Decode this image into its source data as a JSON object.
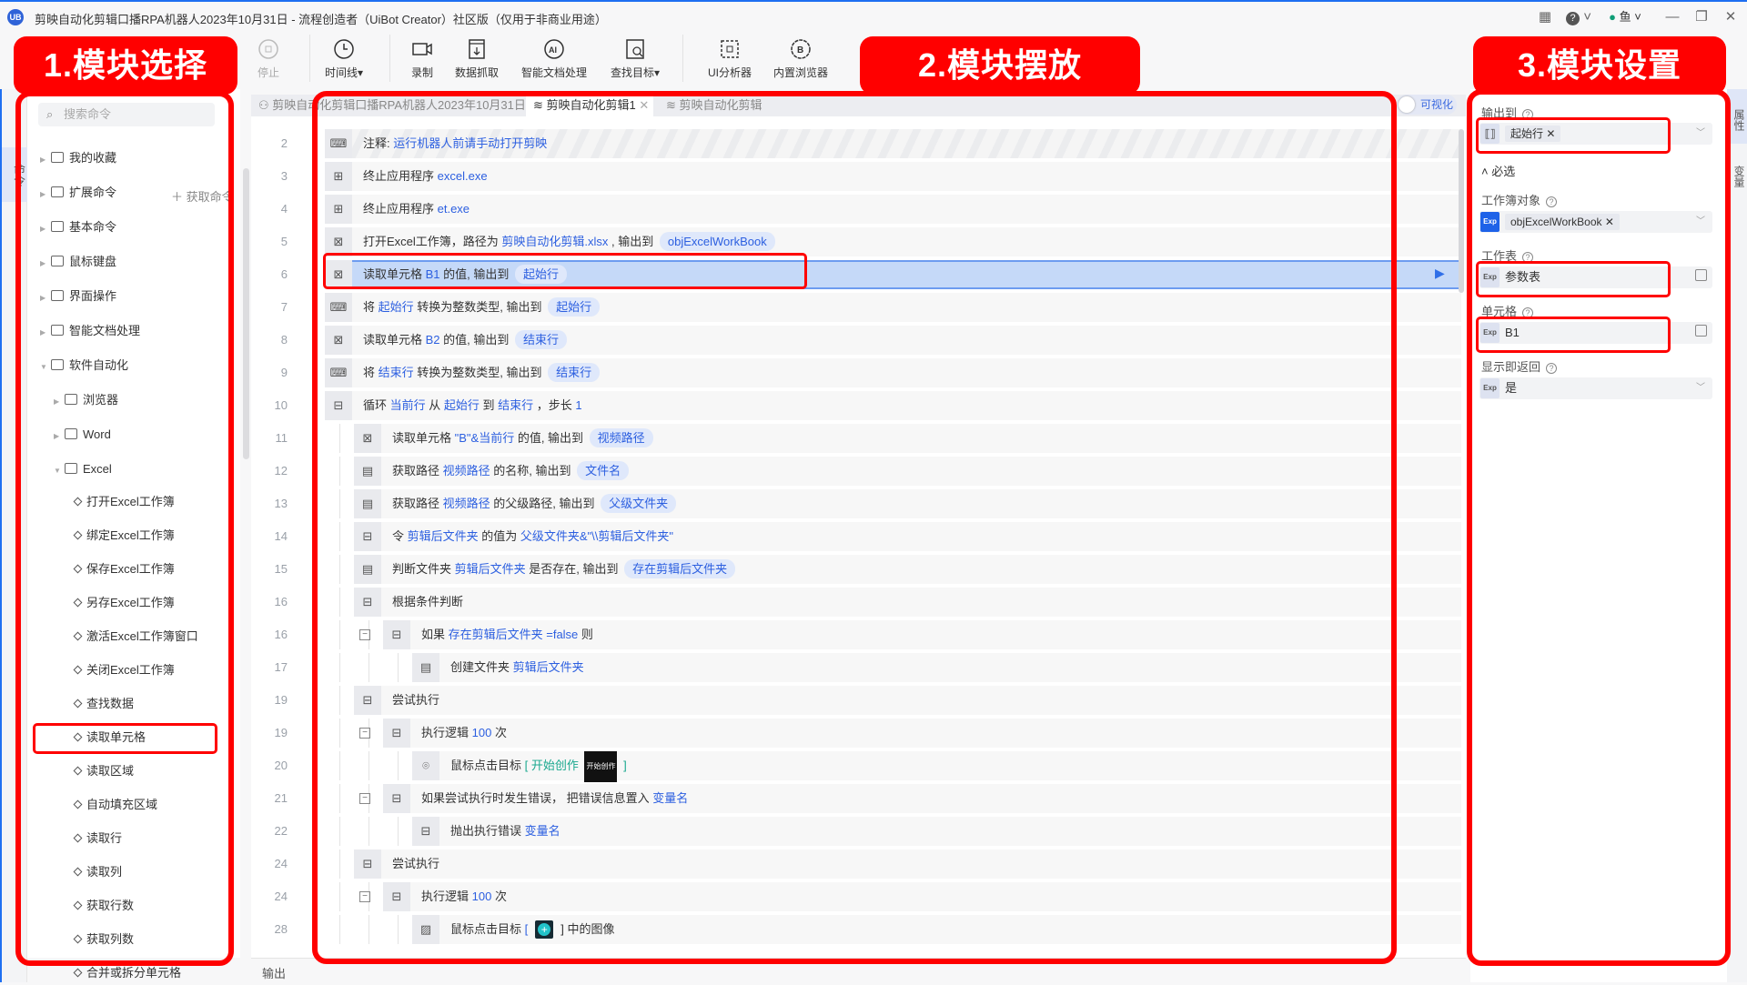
{
  "window": {
    "title": "剪映自动化剪辑口播RPA机器人2023年10月31日 - 流程创造者（UiBot Creator）社区版（仅用于非商业用途）",
    "logo": "UB",
    "user": "鱼",
    "controls": [
      "apps-icon",
      "help-icon",
      "minimize-icon",
      "restore-icon",
      "close-icon"
    ]
  },
  "toolbar": {
    "items": [
      {
        "label": "停止",
        "icon": "stop-icon"
      },
      {
        "label": "时间线▾",
        "icon": "clock-icon"
      },
      {
        "label": "录制",
        "icon": "record-icon"
      },
      {
        "label": "数据抓取",
        "icon": "data-scrape-icon"
      },
      {
        "label": "智能文档处理",
        "icon": "ai-doc-icon"
      },
      {
        "label": "查找目标▾",
        "icon": "find-target-icon"
      },
      {
        "label": "UI分析器",
        "icon": "ui-analyzer-icon"
      },
      {
        "label": "内置浏览器",
        "icon": "browser-icon"
      }
    ]
  },
  "annotations": {
    "section1": "1.模块选择",
    "section2": "2.模块摆放",
    "section3": "3.模块设置",
    "color": "#ff0000"
  },
  "left_strip": {
    "tab": "命令"
  },
  "command_panel": {
    "search_placeholder": "搜索命令",
    "get_commands": "获取命令",
    "categories": [
      {
        "label": "我的收藏",
        "level": 0,
        "expanded": false
      },
      {
        "label": "扩展命令",
        "level": 0,
        "expanded": false
      },
      {
        "label": "基本命令",
        "level": 0,
        "expanded": false
      },
      {
        "label": "鼠标键盘",
        "level": 0,
        "expanded": false
      },
      {
        "label": "界面操作",
        "level": 0,
        "expanded": false
      },
      {
        "label": "智能文档处理",
        "level": 0,
        "expanded": false
      },
      {
        "label": "软件自动化",
        "level": 0,
        "expanded": true
      },
      {
        "label": "浏览器",
        "level": 1,
        "expanded": false
      },
      {
        "label": "Word",
        "level": 1,
        "expanded": false
      },
      {
        "label": "Excel",
        "level": 1,
        "expanded": true
      }
    ],
    "excel_commands": [
      "打开Excel工作簿",
      "绑定Excel工作簿",
      "保存Excel工作簿",
      "另存Excel工作簿",
      "激活Excel工作簿窗口",
      "关闭Excel工作簿",
      "查找数据",
      "读取单元格",
      "读取区域",
      "自动填充区域",
      "读取行",
      "读取列",
      "获取行数",
      "获取列数",
      "合并或拆分单元格"
    ],
    "selected_command": "读取单元格"
  },
  "editor": {
    "tabs": [
      {
        "label": "剪映自动化剪辑口播RPA机器人2023年10月31日",
        "active": false
      },
      {
        "label": "剪映自动化剪辑1",
        "active": true
      },
      {
        "label": "剪映自动化剪辑",
        "active": false
      }
    ],
    "visual_toggle": "可视化",
    "output_label": "输出",
    "rows": [
      {
        "line": "2",
        "indent": 0,
        "icon": "terminal-icon",
        "comment": true,
        "segs": [
          {
            "t": "注释: ",
            "s": "plain"
          },
          {
            "t": "运行机器人前请手动打开剪映",
            "s": "var"
          }
        ]
      },
      {
        "line": "3",
        "indent": 0,
        "icon": "apps-icon",
        "segs": [
          {
            "t": "终止应用程序 ",
            "s": "plain"
          },
          {
            "t": "excel.exe",
            "s": "var"
          }
        ]
      },
      {
        "line": "4",
        "indent": 0,
        "icon": "apps-icon",
        "segs": [
          {
            "t": "终止应用程序 ",
            "s": "plain"
          },
          {
            "t": "et.exe",
            "s": "var"
          }
        ]
      },
      {
        "line": "5",
        "indent": 0,
        "icon": "excel-icon",
        "segs": [
          {
            "t": "打开Excel工作簿，路径为 ",
            "s": "plain"
          },
          {
            "t": "剪映自动化剪辑.xlsx",
            "s": "var"
          },
          {
            "t": " , 输出到 ",
            "s": "plain"
          },
          {
            "t": "objExcelWorkBook",
            "s": "pill"
          }
        ]
      },
      {
        "line": "6",
        "indent": 0,
        "icon": "excel-icon",
        "selected": true,
        "segs": [
          {
            "t": "读取单元格 ",
            "s": "plain"
          },
          {
            "t": "B1",
            "s": "var"
          },
          {
            "t": " 的值, 输出到 ",
            "s": "plain"
          },
          {
            "t": "起始行",
            "s": "pill"
          }
        ]
      },
      {
        "line": "7",
        "indent": 0,
        "icon": "terminal-icon",
        "segs": [
          {
            "t": "将 ",
            "s": "plain"
          },
          {
            "t": "起始行",
            "s": "var"
          },
          {
            "t": " 转换为整数类型, 输出到 ",
            "s": "plain"
          },
          {
            "t": "起始行",
            "s": "pill"
          }
        ]
      },
      {
        "line": "8",
        "indent": 0,
        "icon": "excel-icon",
        "segs": [
          {
            "t": "读取单元格 ",
            "s": "plain"
          },
          {
            "t": "B2",
            "s": "var"
          },
          {
            "t": " 的值, 输出到 ",
            "s": "plain"
          },
          {
            "t": "结束行",
            "s": "pill"
          }
        ]
      },
      {
        "line": "9",
        "indent": 0,
        "icon": "terminal-icon",
        "segs": [
          {
            "t": "将 ",
            "s": "plain"
          },
          {
            "t": "结束行",
            "s": "var"
          },
          {
            "t": " 转换为整数类型, 输出到 ",
            "s": "plain"
          },
          {
            "t": "结束行",
            "s": "pill"
          }
        ]
      },
      {
        "line": "10",
        "indent": 0,
        "icon": "flow-icon",
        "segs": [
          {
            "t": "循环 ",
            "s": "plain"
          },
          {
            "t": "当前行",
            "s": "var"
          },
          {
            "t": " 从 ",
            "s": "plain"
          },
          {
            "t": "起始行",
            "s": "var"
          },
          {
            "t": " 到 ",
            "s": "plain"
          },
          {
            "t": "结束行",
            "s": "var"
          },
          {
            "t": " ，步长 ",
            "s": "plain"
          },
          {
            "t": "1",
            "s": "var"
          }
        ]
      },
      {
        "line": "11",
        "indent": 1,
        "icon": "excel-icon",
        "segs": [
          {
            "t": "读取单元格 ",
            "s": "plain"
          },
          {
            "t": "\"B\"&当前行",
            "s": "var"
          },
          {
            "t": " 的值, 输出到 ",
            "s": "plain"
          },
          {
            "t": "视频路径",
            "s": "pill"
          }
        ]
      },
      {
        "line": "12",
        "indent": 1,
        "icon": "file-icon",
        "segs": [
          {
            "t": "获取路径 ",
            "s": "plain"
          },
          {
            "t": "视频路径",
            "s": "var"
          },
          {
            "t": " 的名称, 输出到 ",
            "s": "plain"
          },
          {
            "t": "文件名",
            "s": "pill"
          }
        ]
      },
      {
        "line": "13",
        "indent": 1,
        "icon": "file-icon",
        "segs": [
          {
            "t": "获取路径 ",
            "s": "plain"
          },
          {
            "t": "视频路径",
            "s": "var"
          },
          {
            "t": " 的父级路径, 输出到 ",
            "s": "plain"
          },
          {
            "t": "父级文件夹",
            "s": "pill"
          }
        ]
      },
      {
        "line": "14",
        "indent": 1,
        "icon": "flow-icon",
        "segs": [
          {
            "t": "令 ",
            "s": "plain"
          },
          {
            "t": "剪辑后文件夹",
            "s": "var"
          },
          {
            "t": " 的值为 ",
            "s": "plain"
          },
          {
            "t": "父级文件夹&\"\\\\剪辑后文件夹\"",
            "s": "var"
          }
        ]
      },
      {
        "line": "15",
        "indent": 1,
        "icon": "file-icon",
        "segs": [
          {
            "t": "判断文件夹 ",
            "s": "plain"
          },
          {
            "t": "剪辑后文件夹",
            "s": "var"
          },
          {
            "t": " 是否存在, 输出到 ",
            "s": "plain"
          },
          {
            "t": "存在剪辑后文件夹",
            "s": "pill"
          }
        ]
      },
      {
        "line": "16",
        "indent": 1,
        "icon": "flow-icon",
        "segs": [
          {
            "t": "根据条件判断",
            "s": "plain"
          }
        ]
      },
      {
        "line": "16",
        "indent": 2,
        "icon": "flow-icon",
        "collapse": true,
        "segs": [
          {
            "t": "如果 ",
            "s": "plain"
          },
          {
            "t": "存在剪辑后文件夹 =false",
            "s": "var"
          },
          {
            "t": " 则",
            "s": "plain"
          }
        ]
      },
      {
        "line": "17",
        "indent": 3,
        "icon": "file-icon",
        "segs": [
          {
            "t": "创建文件夹 ",
            "s": "plain"
          },
          {
            "t": "剪辑后文件夹",
            "s": "var"
          }
        ]
      },
      {
        "line": "19",
        "indent": 1,
        "icon": "flow-icon",
        "segs": [
          {
            "t": "尝试执行",
            "s": "plain"
          }
        ]
      },
      {
        "line": "19",
        "indent": 2,
        "icon": "flow-icon",
        "collapse": true,
        "segs": [
          {
            "t": "执行逻辑 ",
            "s": "plain"
          },
          {
            "t": "100",
            "s": "var"
          },
          {
            "t": " 次",
            "s": "plain"
          }
        ]
      },
      {
        "line": "20",
        "indent": 3,
        "icon": "mouse-icon",
        "segs": [
          {
            "t": "鼠标点击目标 ",
            "s": "plain"
          },
          {
            "t": "[ 开始创作 ",
            "s": "green"
          },
          {
            "t": "开始创作",
            "s": "thumb"
          },
          {
            "t": " ]",
            "s": "green"
          }
        ]
      },
      {
        "line": "21",
        "indent": 2,
        "icon": "flow-icon",
        "collapse": true,
        "segs": [
          {
            "t": "如果尝试执行时发生错误， 把错误信息置入 ",
            "s": "plain"
          },
          {
            "t": "变量名",
            "s": "var"
          }
        ]
      },
      {
        "line": "22",
        "indent": 3,
        "icon": "flow-icon",
        "segs": [
          {
            "t": "抛出执行错误 ",
            "s": "plain"
          },
          {
            "t": "变量名",
            "s": "var"
          }
        ]
      },
      {
        "line": "24",
        "indent": 1,
        "icon": "flow-icon",
        "segs": [
          {
            "t": "尝试执行",
            "s": "plain"
          }
        ]
      },
      {
        "line": "24",
        "indent": 2,
        "icon": "flow-icon",
        "collapse": true,
        "segs": [
          {
            "t": "执行逻辑 ",
            "s": "plain"
          },
          {
            "t": "100",
            "s": "var"
          },
          {
            "t": " 次",
            "s": "plain"
          }
        ]
      },
      {
        "line": "28",
        "indent": 3,
        "icon": "image-icon",
        "segs": [
          {
            "t": "鼠标点击目标 ",
            "s": "plain"
          },
          {
            "t": "[",
            "s": "var"
          },
          {
            "t": "",
            "s": "thumbimg"
          },
          {
            "t": "] 中的图像",
            "s": "plain"
          }
        ]
      }
    ]
  },
  "properties": {
    "strip_tabs": [
      "属性",
      "变量"
    ],
    "output_to": {
      "label": "输出到",
      "value": "起始行"
    },
    "required_section": "必选",
    "workbook": {
      "label": "工作簿对象",
      "value": "objExcelWorkBook"
    },
    "sheet": {
      "label": "工作表",
      "value": "参数表"
    },
    "cell": {
      "label": "单元格",
      "value": "B1"
    },
    "return_display": {
      "label": "显示即返回",
      "value": "是"
    },
    "exp_tag": "Exp"
  }
}
